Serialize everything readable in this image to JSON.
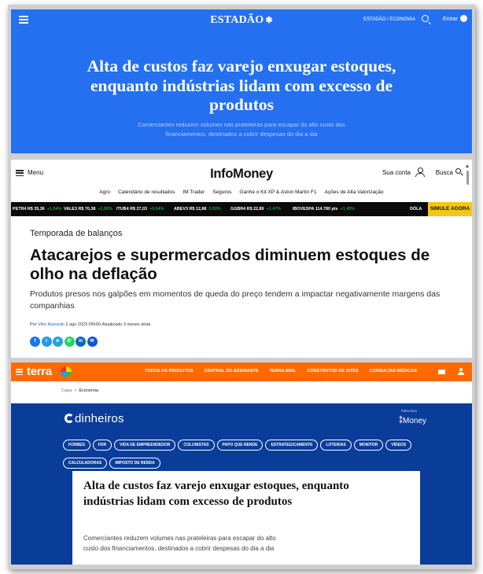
{
  "estadao": {
    "logo": "ESTADÃO",
    "logo_mark": "✱",
    "section": "ESTADÃO / ECONOMIA",
    "login": "Entrar",
    "title": "Alta de custos faz varejo enxugar estoques, enquanto indústrias lidam com excesso de produtos",
    "subtitle": "Comerciantes reduzem volumes nas prateleiras para escapar do alto custo dos financiamentos, destinados a cobrir despesas do dia a dia"
  },
  "infomoney": {
    "menu_label": "Menu",
    "logo": "InfoMoney",
    "account_label": "Sua conta",
    "search_label": "Busca",
    "nav": [
      "Agro",
      "Calendário de resultados",
      "IM Trader",
      "Seguros",
      "Ganhe o Kit XP & Aston Martin F1",
      "Ações de Alta Valorização"
    ],
    "ticker": [
      {
        "name": "PETR4",
        "price": "R$ 35,36",
        "change": "+1,84%"
      },
      {
        "name": "VALE3",
        "price": "R$ 70,38",
        "change": "+1,90%"
      },
      {
        "name": "ITUB4",
        "price": "R$ 27,03",
        "change": "+0,64%"
      },
      {
        "name": "ABEV3",
        "price": "R$ 12,88",
        "change": "0,00%"
      },
      {
        "name": "GGBR4",
        "price": "R$ 22,89",
        "change": "+1,47%"
      },
      {
        "name": "IBOVESPA",
        "price": "114.780 pts",
        "change": "+1,45%"
      },
      {
        "name": "DÓLA",
        "price": "",
        "change": ""
      }
    ],
    "cta": "SIMULE AGORA",
    "kicker": "Temporada de balanços",
    "title": "Atacarejos e supermercados diminuem estoques de olho na deflação",
    "subtitle": "Produtos presos nos galpões em momentos de queda do preço tendem a impactar negativamente margens das companhias",
    "byline_prefix": "Por",
    "author": "Vitor Azevedo",
    "date": "2 ago 2023 05h00-Atualizado 3 meses atrás",
    "share_icons": [
      "facebook-icon",
      "twitter-icon",
      "telegram-icon",
      "whatsapp-icon",
      "linkedin-icon",
      "email-icon"
    ]
  },
  "terra": {
    "logo": "terra",
    "nav": [
      "TODOS OS PRODUTOS",
      "CENTRAL DO ASSINANTE",
      "TERRA MAIL",
      "CONSTRUTOR DE SITES",
      "CONSULTAS MÉDICAS"
    ],
    "breadcrumb_home": "Capa",
    "breadcrumb_sep": ">",
    "breadcrumb_current": "Economia",
    "brand": "dinheiros",
    "sponsor_label": "Patrocínio",
    "sponsor": "Money",
    "tags": [
      "FORBES",
      "FDR",
      "VIDA DE EMPREENDEDOR",
      "COLUNISTAS",
      "PAPO QUE RENDE",
      "ESTRATEGICAMENTE",
      "LOTERIAS",
      "MONITOR",
      "VÍDEOS",
      "CALCULADORAS",
      "IMPOSTO DE RENDA"
    ],
    "title": "Alta de custos faz varejo enxugar estoques, enquanto indústrias lidam com excesso de produtos",
    "subtitle": "Comerciantes reduzem volumes nas prateleiras para escapar do alto custo dos financiamentos, destinados a cobrir despesas do dia a dia"
  }
}
